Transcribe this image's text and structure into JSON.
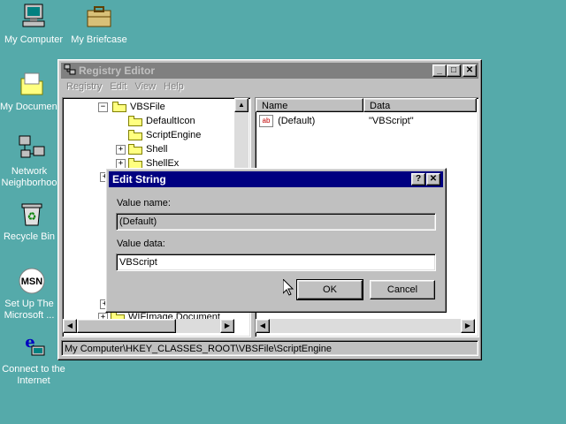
{
  "desktop": {
    "icons": [
      {
        "label": "My Computer"
      },
      {
        "label": "My Briefcase"
      },
      {
        "label": "My Documen"
      },
      {
        "label": "Network Neighborhoo"
      },
      {
        "label": "Recycle Bin"
      },
      {
        "label": "Set Up The Microsoft ..."
      },
      {
        "label": "Connect to the Internet"
      }
    ]
  },
  "regedit": {
    "title": "Registry Editor",
    "menu": [
      "Registry",
      "Edit",
      "View",
      "Help"
    ],
    "tree": [
      {
        "label": "VBSFile",
        "expander": "−"
      },
      {
        "label": "DefaultIcon",
        "expander": ""
      },
      {
        "label": "ScriptEngine",
        "expander": ""
      },
      {
        "label": "Shell",
        "expander": "+"
      },
      {
        "label": "ShellEx",
        "expander": "+"
      },
      {
        "label": "WIFImage.Document",
        "expander": "+"
      }
    ],
    "columns": {
      "name": "Name",
      "data": "Data"
    },
    "values": [
      {
        "name": "(Default)",
        "data": "\"VBScript\"",
        "icon": "string-value-icon"
      }
    ],
    "status": "My Computer\\HKEY_CLASSES_ROOT\\VBSFile\\ScriptEngine"
  },
  "dialog": {
    "title": "Edit String",
    "value_name_label": "Value name:",
    "value_name": "(Default)",
    "value_data_label": "Value data:",
    "value_data": "VBScript",
    "ok_label": "OK",
    "cancel_label": "Cancel"
  },
  "colors": {
    "desktop": "#55aaaa",
    "active_title": "#000080",
    "inactive_title": "#808080",
    "face": "#c0c0c0"
  }
}
